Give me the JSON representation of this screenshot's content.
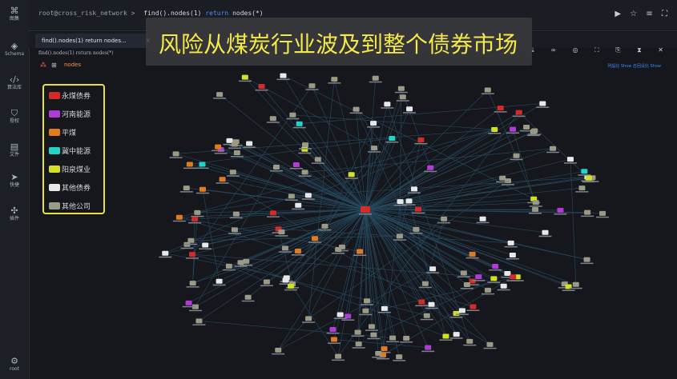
{
  "sidebar": {
    "items": [
      {
        "label": "图集",
        "icon": "graph-icon"
      },
      {
        "label": "Schema",
        "icon": "layers-icon"
      },
      {
        "label": "算法库",
        "icon": "code-icon"
      },
      {
        "label": "授权",
        "icon": "shield-icon"
      },
      {
        "label": "文件",
        "icon": "file-icon"
      },
      {
        "label": "快捷",
        "icon": "send-icon"
      },
      {
        "label": "插件",
        "icon": "puzzle-icon"
      }
    ],
    "user": {
      "label": "root",
      "icon": "gear-icon"
    }
  },
  "topbar": {
    "prefix": "root@cross_risk_network >",
    "query_a": "find().nodes(1)",
    "query_kw": "return",
    "query_b": "nodes(*)",
    "icons": "▶ ☆ ≡ ⛶"
  },
  "tab": {
    "label": "find().nodes(1) return nodes...",
    "close": "×"
  },
  "subbar": {
    "query": "find().nodes(1) return nodes(*)",
    "icons": "⌕ ⤓ ∞ ◎ ⛶ ⎘ ⧗ ✕"
  },
  "viewbar": {
    "nodes_label": "nodes",
    "right": "列設比 Show  召回设比 Show"
  },
  "banner": {
    "title": "风险从煤炭行业波及到整个债券市场"
  },
  "legend": {
    "items": [
      {
        "label": "永煤债券",
        "color": "#d42a2a"
      },
      {
        "label": "河南能源",
        "color": "#b23ad6"
      },
      {
        "label": "平煤",
        "color": "#e07b22"
      },
      {
        "label": "冀中能源",
        "color": "#22d4c8"
      },
      {
        "label": "阳泉煤业",
        "color": "#d4e022"
      },
      {
        "label": "其他债券",
        "color": "#e8e8e8"
      },
      {
        "label": "其他公司",
        "color": "#9a9a85"
      }
    ]
  }
}
